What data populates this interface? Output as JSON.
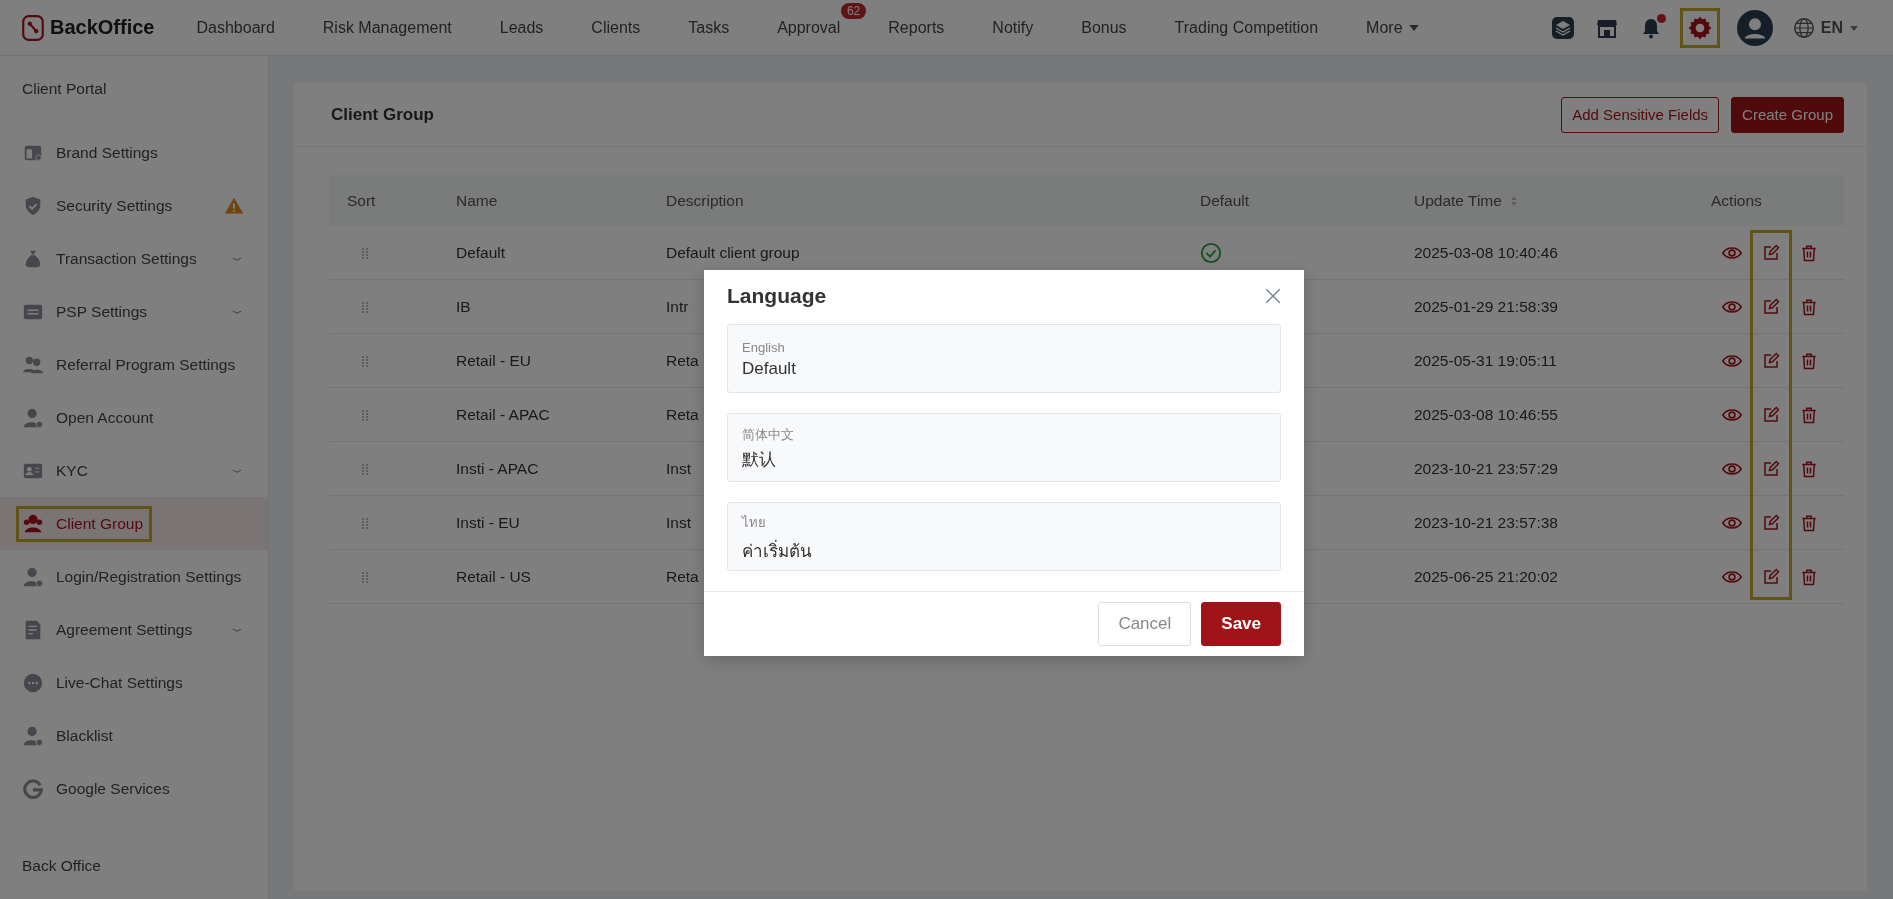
{
  "topbar": {
    "logo": "BackOffice",
    "nav": [
      {
        "label": "Dashboard"
      },
      {
        "label": "Risk Management"
      },
      {
        "label": "Leads"
      },
      {
        "label": "Clients"
      },
      {
        "label": "Tasks"
      },
      {
        "label": "Approval",
        "badge": "62"
      },
      {
        "label": "Reports"
      },
      {
        "label": "Notify"
      },
      {
        "label": "Bonus"
      },
      {
        "label": "Trading Competition"
      },
      {
        "label": "More",
        "dropdown": true
      }
    ],
    "notification_dot": true,
    "settings_highlighted": true,
    "language": "EN"
  },
  "sidebar": {
    "sections": [
      {
        "title": "Client Portal",
        "items": [
          {
            "label": "Brand Settings",
            "expandable": false,
            "warning": false,
            "selected": false
          },
          {
            "label": "Security Settings",
            "expandable": false,
            "warning": true,
            "selected": false
          },
          {
            "label": "Transaction Settings",
            "expandable": true,
            "warning": false,
            "selected": false
          },
          {
            "label": "PSP Settings",
            "expandable": true,
            "warning": false,
            "selected": false
          },
          {
            "label": "Referral Program Settings",
            "expandable": false,
            "warning": false,
            "selected": false
          },
          {
            "label": "Open Account",
            "expandable": false,
            "warning": false,
            "selected": false
          },
          {
            "label": "KYC",
            "expandable": true,
            "warning": false,
            "selected": false
          },
          {
            "label": "Client Group",
            "expandable": false,
            "warning": false,
            "selected": true,
            "highlighted": true
          },
          {
            "label": "Login/Registration Settings",
            "expandable": false,
            "warning": false,
            "selected": false
          },
          {
            "label": "Agreement Settings",
            "expandable": true,
            "warning": false,
            "selected": false
          },
          {
            "label": "Live-Chat Settings",
            "expandable": false,
            "warning": false,
            "selected": false
          },
          {
            "label": "Blacklist",
            "expandable": false,
            "warning": false,
            "selected": false
          },
          {
            "label": "Google Services",
            "expandable": false,
            "warning": false,
            "selected": false
          }
        ]
      },
      {
        "title": "Back Office"
      }
    ]
  },
  "card": {
    "title": "Client Group",
    "buttons": [
      {
        "label": "Add Sensitive Fields",
        "kind": "outline"
      },
      {
        "label": "Create Group",
        "kind": "primary"
      }
    ],
    "table": {
      "columns": [
        {
          "label": "Sort"
        },
        {
          "label": "Name"
        },
        {
          "label": "Description"
        },
        {
          "label": "Default"
        },
        {
          "label": "Update Time",
          "sortable": true
        },
        {
          "label": "Actions"
        }
      ],
      "edit_highlighted": true,
      "rows": [
        {
          "name": "Default",
          "description": "Default client group",
          "default": true,
          "update_time": "2025-03-08 10:40:46"
        },
        {
          "name": "IB",
          "description": "Intr",
          "default": false,
          "update_time": "2025-01-29 21:58:39"
        },
        {
          "name": "Retail - EU",
          "description": "Reta",
          "default": false,
          "update_time": "2025-05-31 19:05:11"
        },
        {
          "name": "Retail - APAC",
          "description": "Reta",
          "default": false,
          "update_time": "2025-03-08 10:46:55"
        },
        {
          "name": "Insti - APAC",
          "description": "Inst",
          "default": false,
          "update_time": "2023-10-21 23:57:29"
        },
        {
          "name": "Insti - EU",
          "description": "Inst",
          "default": false,
          "update_time": "2023-10-21 23:57:38"
        },
        {
          "name": "Retail - US",
          "description": "Reta",
          "default": false,
          "update_time": "2025-06-25 21:20:02"
        }
      ]
    }
  },
  "modal": {
    "title": "Language",
    "fields": [
      {
        "label": "English",
        "value": "Default"
      },
      {
        "label": "简体中文",
        "value": "默认"
      },
      {
        "label": "ไทย",
        "value": "ค่าเริ่มต้น"
      }
    ],
    "buttons": [
      {
        "label": "Cancel",
        "kind": "secondary"
      },
      {
        "label": "Save",
        "kind": "primary"
      }
    ]
  }
}
